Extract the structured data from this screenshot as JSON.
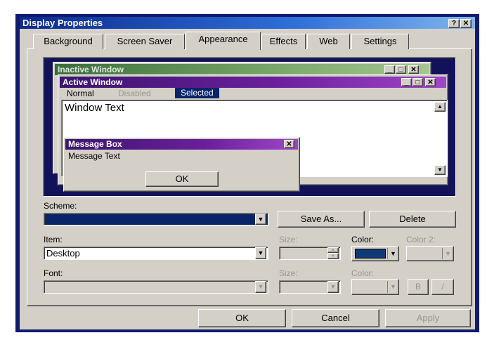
{
  "window": {
    "title": "Display Properties",
    "help_glyph": "?",
    "close_glyph": "✕"
  },
  "tabs": [
    {
      "label": "Background"
    },
    {
      "label": "Screen Saver"
    },
    {
      "label": "Appearance"
    },
    {
      "label": "Effects"
    },
    {
      "label": "Web"
    },
    {
      "label": "Settings"
    }
  ],
  "preview": {
    "inactive_title": "Inactive Window",
    "active_title": "Active Window",
    "menu": [
      "Normal",
      "Disabled",
      "Selected"
    ],
    "window_text": "Window Text",
    "message_box": {
      "title": "Message Box",
      "text": "Message Text",
      "ok": "OK"
    },
    "desktop_color": "#12125a"
  },
  "scheme": {
    "label": "Scheme:",
    "value": "",
    "save_as": "Save As...",
    "delete": "Delete"
  },
  "item": {
    "label": "Item:",
    "value": "Desktop",
    "size_label": "Size:",
    "color_label": "Color:",
    "color2_label": "Color 2:",
    "color_value": "#103a75"
  },
  "font": {
    "label": "Font:",
    "size_label": "Size:",
    "color_label": "Color:",
    "bold": "B",
    "italic": "/"
  },
  "buttons": {
    "ok": "OK",
    "cancel": "Cancel",
    "apply": "Apply"
  }
}
